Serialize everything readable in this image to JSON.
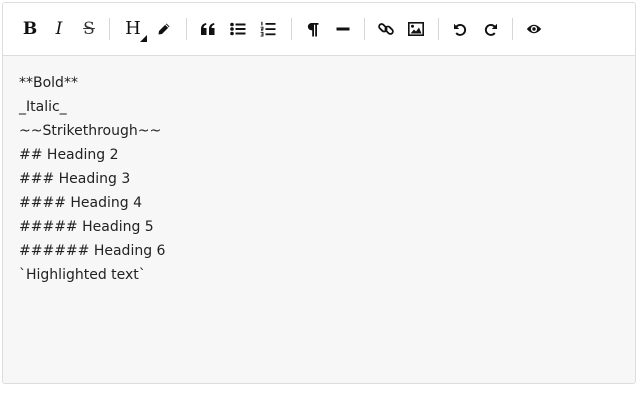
{
  "toolbar": {
    "bold_glyph": "B",
    "italic_glyph": "I",
    "strikethrough_glyph": "S",
    "heading_glyph": "H",
    "icons": [
      "bold-icon",
      "italic-icon",
      "strikethrough-icon",
      "heading-icon",
      "highlight-icon",
      "quote-icon",
      "unordered-list-icon",
      "ordered-list-icon",
      "paragraph-icon",
      "horizontal-rule-icon",
      "link-icon",
      "image-icon",
      "undo-icon",
      "redo-icon",
      "preview-icon"
    ]
  },
  "content": {
    "lines": [
      "**Bold**",
      "_Italic_",
      "~~Strikethrough~~",
      "## Heading 2",
      "### Heading 3",
      "#### Heading 4",
      "##### Heading 5",
      "###### Heading 6",
      "`Highlighted text`"
    ]
  }
}
